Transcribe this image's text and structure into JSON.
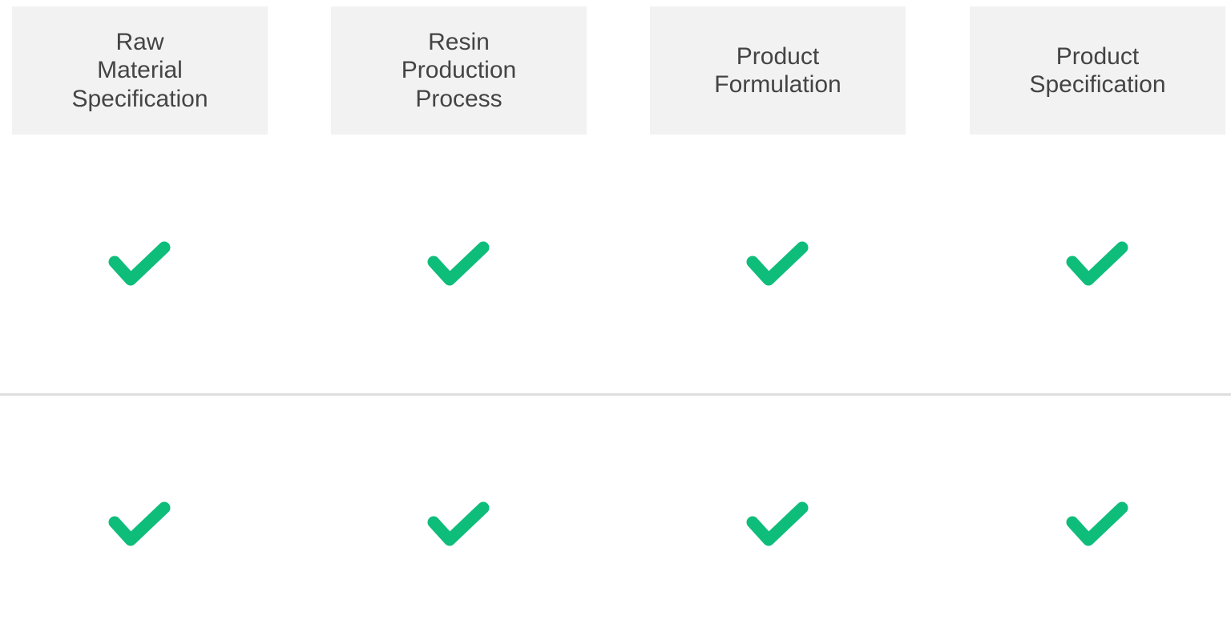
{
  "table": {
    "headers": [
      "Raw\nMaterial\nSpecification",
      "Resin\nProduction\nProcess",
      "Product\nFormulation",
      "Product\nSpecification"
    ],
    "rows": [
      {
        "checks": [
          "check-icon",
          "check-icon",
          "check-icon",
          "check-icon"
        ]
      },
      {
        "checks": [
          "check-icon",
          "check-icon",
          "check-icon",
          "check-icon"
        ]
      }
    ]
  },
  "colors": {
    "header_background": "#f2f2f2",
    "header_text": "#444444",
    "check": "#0fbd7b",
    "divider": "#dedede"
  }
}
